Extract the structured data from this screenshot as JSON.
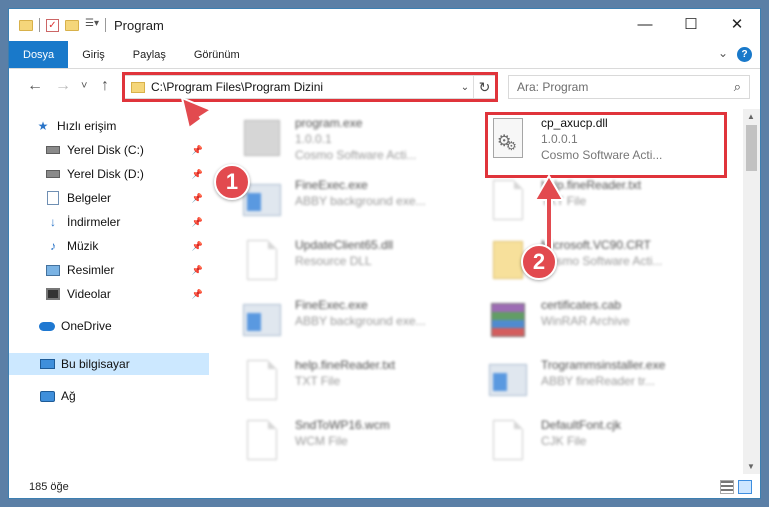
{
  "window": {
    "title": "Program"
  },
  "ribbon": {
    "tabs": [
      "Dosya",
      "Giriş",
      "Paylaş",
      "Görünüm"
    ],
    "help": "?"
  },
  "nav_buttons": {
    "back": "←",
    "forward": "→",
    "recent": "˅",
    "up": "↑"
  },
  "address": {
    "path": "C:\\Program Files\\Program Dizini",
    "dropdown": "⌄",
    "refresh": "↻"
  },
  "search": {
    "placeholder": "Ara: Program",
    "icon": "search-icon"
  },
  "sidebar": {
    "items": [
      {
        "label": "Hızlı erişim",
        "icon": "star-icon"
      },
      {
        "label": "Yerel Disk (C:)",
        "icon": "drive-icon",
        "pinned": true
      },
      {
        "label": "Yerel Disk (D:)",
        "icon": "drive-icon",
        "pinned": true
      },
      {
        "label": "Belgeler",
        "icon": "documents-icon",
        "pinned": true
      },
      {
        "label": "İndirmeler",
        "icon": "download-icon",
        "pinned": true
      },
      {
        "label": "Müzik",
        "icon": "music-icon",
        "pinned": true
      },
      {
        "label": "Resimler",
        "icon": "pictures-icon",
        "pinned": true
      },
      {
        "label": "Videolar",
        "icon": "videos-icon",
        "pinned": true
      },
      {
        "label": "OneDrive",
        "icon": "cloud-icon"
      },
      {
        "label": "Bu bilgisayar",
        "icon": "computer-icon",
        "selected": true
      },
      {
        "label": "Ağ",
        "icon": "network-icon"
      }
    ]
  },
  "files": [
    {
      "name": "program.exe",
      "line2": "1.0.0.1",
      "line3": "Cosmo Software Acti...",
      "icon": "exe-icon",
      "highlight": false
    },
    {
      "name": "cp_axucp.dll",
      "line2": "1.0.0.1",
      "line3": "Cosmo Software Acti...",
      "icon": "dll-icon",
      "highlight": true
    },
    {
      "name": "FineExec.exe",
      "line2": "ABBY background exe...",
      "line3": "",
      "icon": "exe-icon",
      "highlight": false
    },
    {
      "name": "help.fineReader.txt",
      "line2": "TXT File",
      "line3": "",
      "icon": "file-icon",
      "highlight": false
    },
    {
      "name": "UpdateClient65.dll",
      "line2": "Resource DLL",
      "line3": "",
      "icon": "dll-icon",
      "highlight": false
    },
    {
      "name": "Microsoft.VC90.CRT",
      "line2": "Cosmo Software Acti...",
      "line3": "",
      "icon": "folder-icon",
      "highlight": false
    },
    {
      "name": "FineExec.exe",
      "line2": "ABBY background exe...",
      "line3": "",
      "icon": "exe-icon",
      "highlight": false
    },
    {
      "name": "certificates.cab",
      "line2": "WinRAR Archive",
      "line3": "",
      "icon": "archive-icon",
      "highlight": false
    },
    {
      "name": "help.fineReader.txt",
      "line2": "TXT File",
      "line3": "",
      "icon": "file-icon",
      "highlight": false
    },
    {
      "name": "Trogrammsinstaller.exe",
      "line2": "ABBY fineReader tr...",
      "line3": "",
      "icon": "exe-icon",
      "highlight": false
    },
    {
      "name": "SndToWP16.wcm",
      "line2": "WCM File",
      "line3": "",
      "icon": "file-icon",
      "highlight": false
    },
    {
      "name": "DefaultFont.cjk",
      "line2": "CJK File",
      "line3": "",
      "icon": "file-icon",
      "highlight": false
    }
  ],
  "status": {
    "count_text": "185 öğe"
  },
  "callouts": [
    {
      "number": "1"
    },
    {
      "number": "2"
    }
  ],
  "colors": {
    "accent": "#1979ca",
    "highlight": "#e0343b",
    "callout": "#e24a4f",
    "selected_bg": "#cce8ff"
  }
}
